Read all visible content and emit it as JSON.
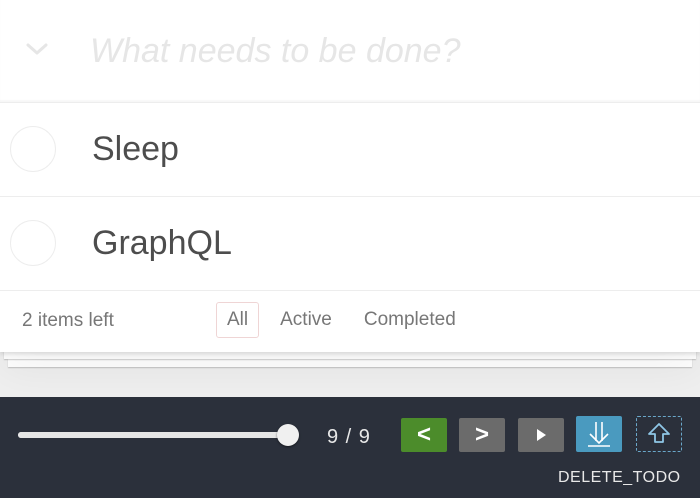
{
  "new_todo": {
    "placeholder": "What needs to be done?",
    "value": ""
  },
  "todos": [
    {
      "title": "Sleep",
      "completed": false
    },
    {
      "title": "GraphQL",
      "completed": false
    }
  ],
  "footer": {
    "count_label": "2 items left",
    "filters": [
      {
        "label": "All",
        "selected": true
      },
      {
        "label": "Active",
        "selected": false
      },
      {
        "label": "Completed",
        "selected": false
      }
    ]
  },
  "devtools": {
    "slider_progress": 1.0,
    "step_counter": "9 / 9",
    "buttons": {
      "prev": "<",
      "next": ">",
      "play_icon": "play-icon",
      "import_icon": "download-icon",
      "export_icon": "upload-icon"
    },
    "action_name": "DELETE_TODO"
  },
  "colors": {
    "prev_button": "#4c8c2b",
    "neutral_button": "#6b6b6b",
    "import_button": "#4a9abf",
    "devbar_bg": "#2b303b"
  }
}
